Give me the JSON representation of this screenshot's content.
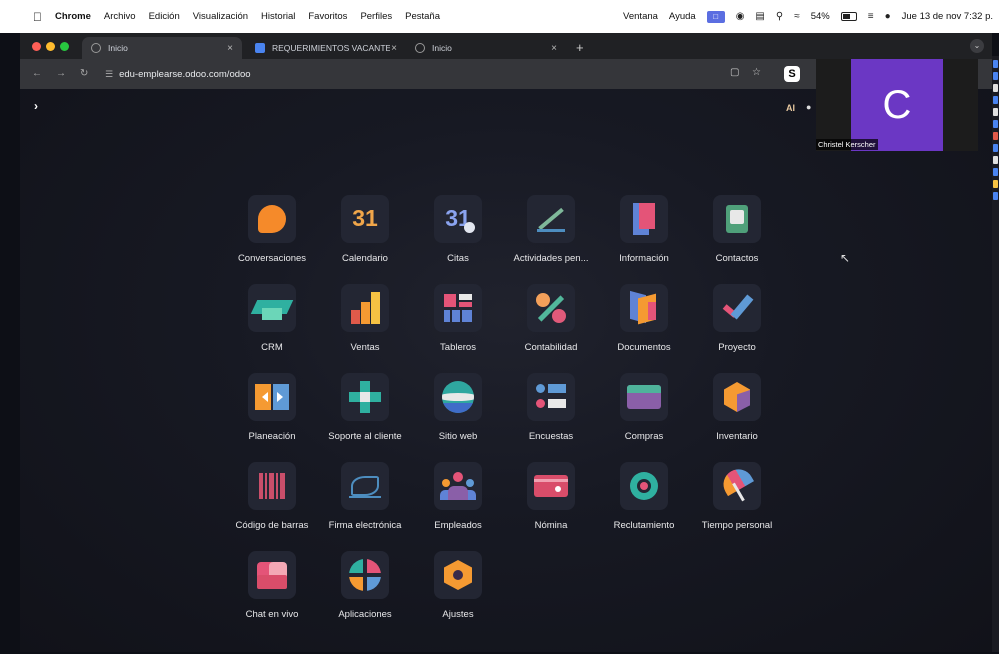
{
  "menubar": {
    "app": "Chrome",
    "items": [
      "Archivo",
      "Edición",
      "Visualización",
      "Historial",
      "Favoritos",
      "Perfiles",
      "Pestaña"
    ],
    "right_items": [
      "Ventana",
      "Ayuda"
    ],
    "battery": "54%",
    "datetime": "Jue 13 de nov 7:32 p."
  },
  "browser": {
    "tabs": [
      {
        "title": "Inicio",
        "active": true
      },
      {
        "title": "REQUERIMIENTOS VACANTE",
        "active": false
      },
      {
        "title": "Inicio",
        "active": false
      }
    ],
    "url": "edu-emplearse.odoo.com/odoo"
  },
  "odoo": {
    "ai_label": "AI",
    "apps": [
      "Conversaciones",
      "Calendario",
      "Citas",
      "Actividades pen...",
      "Información",
      "Contactos",
      "CRM",
      "Ventas",
      "Tableros",
      "Contabilidad",
      "Documentos",
      "Proyecto",
      "Planeación",
      "Soporte al cliente",
      "Sitio web",
      "Encuestas",
      "Compras",
      "Inventario",
      "Código de barras",
      "Firma electrónica",
      "Empleados",
      "Nómina",
      "Reclutamiento",
      "Tiempo personal",
      "Chat en vivo",
      "Aplicaciones",
      "Ajustes"
    ],
    "calendar_day": "31",
    "citas_day": "31"
  },
  "video": {
    "initial": "C",
    "name": "Christel Kerscher"
  },
  "colors": {
    "accent_purple": "#6b37c4",
    "background": "#13151d",
    "tile": "#232633"
  }
}
